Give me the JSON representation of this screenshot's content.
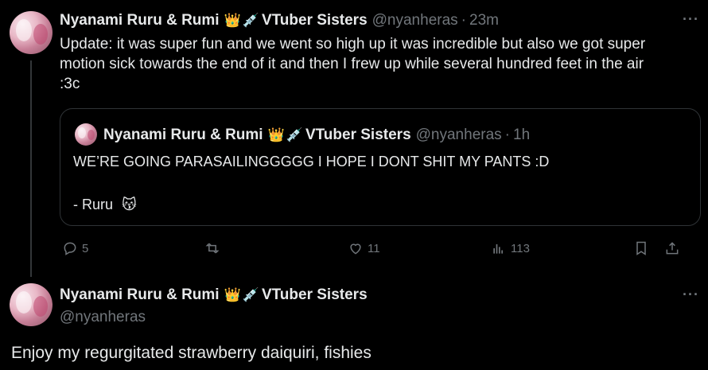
{
  "tweet1": {
    "display_name": "Nyanami Ruru & Rumi",
    "badge_icons": [
      "crown-icon",
      "syringe-icon"
    ],
    "name_suffix": "VTuber Sisters",
    "handle": "@nyanheras",
    "separator": "·",
    "time": "23m",
    "text_lines": [
      "Update: it was super fun and we went so high up it was incredible but also we got super",
      "motion sick towards the end of it and then I frew up while several hundred feet in the air",
      ":3c"
    ],
    "quote": {
      "display_name": "Nyanami Ruru & Rumi",
      "name_suffix": "VTuber Sisters",
      "handle": "@nyanheras",
      "separator": "·",
      "time": "1h",
      "line1": "WE’RE GOING PARASAILINGGGGG I HOPE I DONT SHIT MY PANTS :D",
      "line2": "- Ruru",
      "line2_emoji": "kissing-cat-icon"
    },
    "actions": {
      "replies": "5",
      "reposts": "",
      "likes": "11",
      "views": "113"
    }
  },
  "tweet2": {
    "display_name": "Nyanami Ruru & Rumi",
    "name_suffix": "VTuber Sisters",
    "handle": "@nyanheras",
    "text": "Enjoy my regurgitated strawberry daiquiri, fishies"
  },
  "glyphs": {
    "crown": "👑",
    "syringe": "💉",
    "kissing_cat": "😽",
    "more": "···"
  }
}
